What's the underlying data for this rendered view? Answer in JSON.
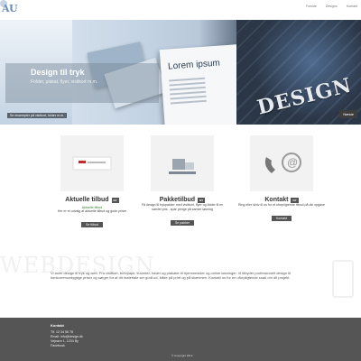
{
  "header": {
    "logo": "AU",
    "nav": [
      "Forside",
      "Designs",
      "Kontakt"
    ]
  },
  "hero": {
    "title": "Design til tryk",
    "subtitle": "Folder, plakat, flyer, visitkort m.m.",
    "paper_title": "Lorem ipsum",
    "design_word": "DESIGN",
    "link_label": "Se eksempler på visitkort, folder m.m.",
    "next_label": "Næste"
  },
  "features": [
    {
      "title": "Aktuelle tilbud",
      "tag": "NY",
      "green": "Aktuelle tilbud",
      "text": "Her er et udvalg af aktuelle tilbud og gode priser",
      "button": "Se tilbud"
    },
    {
      "title": "Pakketilbud",
      "tag": "NY",
      "green": "",
      "text": "Få design til trykpakker med visitkort, flyer og folder til en samlet pris - spar penge på samlet løsning",
      "button": "Se pakker"
    },
    {
      "title": "Kontakt",
      "tag": "NY",
      "green": "",
      "text": "Ring eller skriv til os for et uforpligtende tilbud på din opgave",
      "button": "Kontakt"
    }
  ],
  "watermark": "WEBDESIGN",
  "intro": "Vi laver design til tryk og web. Fra visitkort, brevpapir, kuverter, folder og plakater til hjemmesider og online løsninger. Vi tilbyder professionelt design til konkurrencedygtige priser og sørger for at dit materiale ser godt ud, både på print og på skærmen. Kontakt os for en uforpligtende snak om dit projekt.",
  "footer": {
    "heading": "Kontakt",
    "lines": [
      "Tlf. 12 34 56 78",
      "Email: info@design.dk",
      "Vejnavn 1, 1234 By",
      "Facebook"
    ],
    "copyright": "© Copyright 2013"
  }
}
